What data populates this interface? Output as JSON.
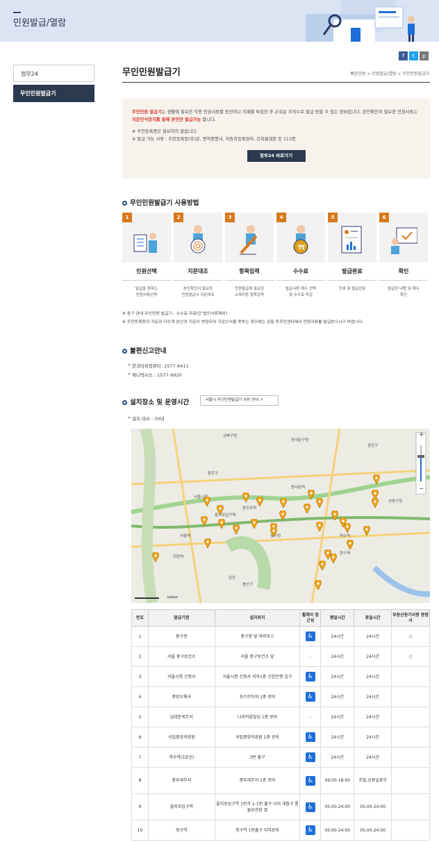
{
  "header": {
    "title": "민원발급/열람"
  },
  "lnb": {
    "items": [
      {
        "label": "정부24"
      },
      {
        "label": "무인민원발급기"
      }
    ]
  },
  "share": {
    "facebook": "f",
    "twitter": "t",
    "print": "p"
  },
  "page": {
    "title": "무인민원발급기",
    "breadcrumb": "빠른민원 > 민원발급/열람 > 무인민원발급기"
  },
  "info": {
    "p1_a": "무인민원 발급기",
    "p1_b": "는 생활에 필요한 각종 민원서류를 동전이나 지폐를 투입한 후 손쉬운 조작으로 발급 받을 수 있는 장비입니다. 본인확인이 필요한 민원서류는 ",
    "p1_c": "지문인식장치를 통해 본인만 발급가능",
    "p1_d": " 합니다.",
    "n1": "※ 주민등록증은 필요하지 않습니다.",
    "n2": "※ 발급 가능 서류 : 주민등록등(초)본, 병적증명서, 자동차등록원부, 건축물대장 등 113종",
    "button": "정부24 바로가기"
  },
  "usage": {
    "title": "무인민원발급기 사용방법",
    "steps": [
      {
        "num": "1",
        "label": "민원선택",
        "desc1": "발급을 원하는",
        "desc2": "민원서류선택"
      },
      {
        "num": "2",
        "label": "지문대조",
        "desc1": "본인확인이 필요한",
        "desc2": "민원발급시 지문대조"
      },
      {
        "num": "3",
        "label": "항목입력",
        "desc1": "민원발급에 필요한",
        "desc2": "소재지등 항목입력"
      },
      {
        "num": "4",
        "label": "수수료",
        "desc1": "발급서류 매수 선택",
        "desc2": "및 수수료 투입"
      },
      {
        "num": "5",
        "label": "발급완료",
        "desc1": "인쇄 및 발급완료",
        "desc2": ""
      },
      {
        "num": "6",
        "label": "확인",
        "desc1": "발급한 내용 및 매수",
        "desc2": "확인"
      }
    ]
  },
  "notes": {
    "n1": "※ 중구 관내 무인민원 발급기 : 수수료 무료(단 법인서류제외)",
    "n2": "※ 주민등록증의 지문과 다르게 본인의 지문이 변형되어 지문인식을 못하는 경우에는 관할 동주민센터에서 민원서류를 발급받으시기 바랍니다."
  },
  "complaint": {
    "title": "불편신고안내",
    "l1": "한국타피컴퓨터 :1577-8411",
    "l2": "에니텍시스 : 1577-9920"
  },
  "location": {
    "title": "설치장소 및 운영시간",
    "link": "서울시 무인민원발급기 위치 안내",
    "count": "설치 대수 : 30대"
  },
  "map": {
    "labels": [
      "성북구청",
      "동대문구청",
      "서울시청",
      "중구청",
      "남산",
      "서울역",
      "용산구",
      "성동구청",
      "광진구",
      "약수역",
      "충무로역",
      "청구역",
      "동대문역",
      "을지로입구역",
      "종로구",
      "회현역"
    ],
    "zoom_plus": "+",
    "zoom_minus": "−",
    "scale": "kakao"
  },
  "table": {
    "headers": [
      "번호",
      "발급기명",
      "설치위치",
      "휠체어 접근성",
      "평일시간",
      "휴일시간",
      "부동산등기사항 증명서"
    ],
    "rows": [
      [
        "1",
        "중구청",
        "중구청 앞 옥외부스",
        "acc",
        "24시간",
        "24시간",
        "○"
      ],
      [
        "2",
        "서울 중구보건소",
        "서울 중구보건소 앞",
        "-",
        "24시간",
        "24시간",
        "○"
      ],
      [
        "3",
        "서울시청 신청사",
        "서울시청 신청사 지하1층 신한은행 입구",
        "acc",
        "24시간",
        "24시간",
        ""
      ],
      [
        "4",
        "중앙우체국",
        "포스트타워 1층 로비",
        "acc",
        "24시간",
        "24시간",
        ""
      ],
      [
        "5",
        "남대문세무서",
        "나라키움빌딩 1층 로비",
        "-",
        "24시간",
        "24시간",
        ""
      ],
      [
        "6",
        "국립중앙의료원",
        "국립중앙의료원 1층 로비",
        "acc",
        "24시간",
        "24시간",
        ""
      ],
      [
        "7",
        "약수역(3호선)",
        "3번 출구",
        "acc",
        "24시간",
        "24시간",
        ""
      ],
      [
        "8",
        "중부세무서",
        "중부세무서 1층 로비",
        "acc",
        "09:00-18:00",
        "주말,공휴일휴무",
        ""
      ],
      [
        "9",
        "을지로입구역",
        "을지로입구역 1번과 1-1번 출구 사이 개찰구 통돌보관함 옆",
        "acc",
        "05:00-24:00",
        "05:00-24:00",
        ""
      ],
      [
        "10",
        "청구역",
        "청구역 1번출구 지하로비",
        "acc",
        "05:00-24:00",
        "05:00-24:00",
        ""
      ]
    ]
  }
}
